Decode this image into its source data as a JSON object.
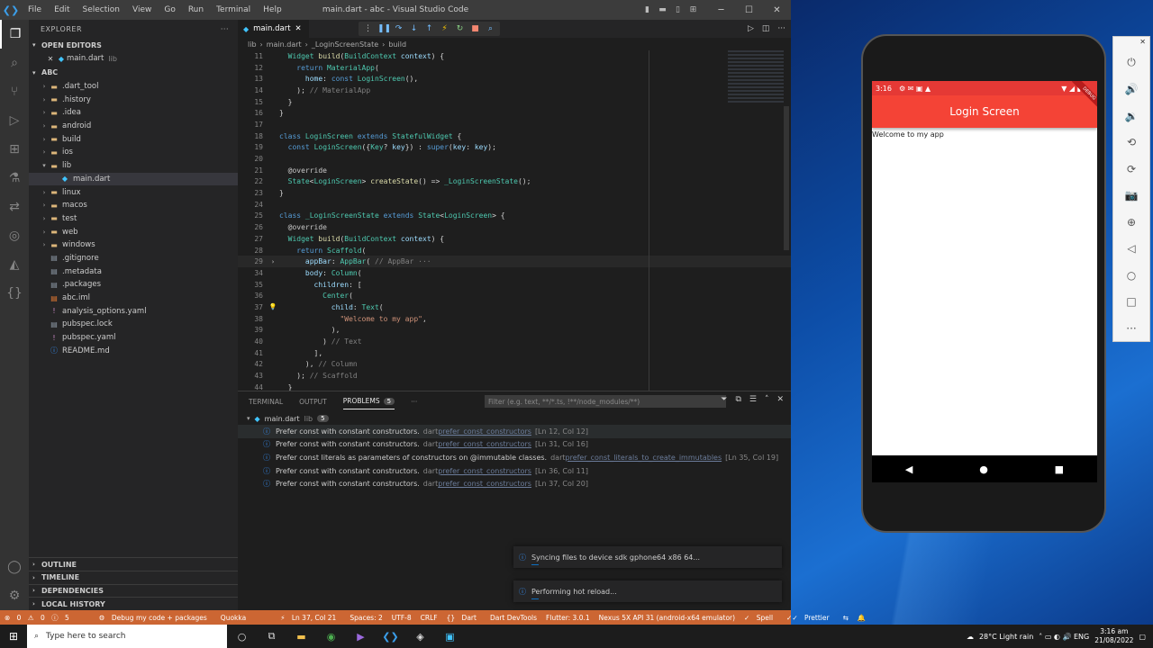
{
  "titlebar": {
    "title": "main.dart - abc - Visual Studio Code",
    "menu": [
      "File",
      "Edit",
      "Selection",
      "View",
      "Go",
      "Run",
      "Terminal",
      "Help"
    ]
  },
  "sidebar": {
    "header": "EXPLORER",
    "open_editors": "OPEN EDITORS",
    "open_file": "main.dart",
    "open_file_dir": "lib",
    "project": "ABC",
    "tree": [
      {
        "name": ".dart_tool",
        "folder": true,
        "depth": 1,
        "open": false
      },
      {
        "name": ".history",
        "folder": true,
        "depth": 1,
        "open": false
      },
      {
        "name": ".idea",
        "folder": true,
        "depth": 1,
        "open": false
      },
      {
        "name": "android",
        "folder": true,
        "depth": 1,
        "open": false
      },
      {
        "name": "build",
        "folder": true,
        "depth": 1,
        "open": false
      },
      {
        "name": "ios",
        "folder": true,
        "depth": 1,
        "open": false
      },
      {
        "name": "lib",
        "folder": true,
        "depth": 1,
        "open": true
      },
      {
        "name": "main.dart",
        "folder": false,
        "depth": 2,
        "selected": true
      },
      {
        "name": "linux",
        "folder": true,
        "depth": 1,
        "open": false
      },
      {
        "name": "macos",
        "folder": true,
        "depth": 1,
        "open": false
      },
      {
        "name": "test",
        "folder": true,
        "depth": 1,
        "open": false
      },
      {
        "name": "web",
        "folder": true,
        "depth": 1,
        "open": false
      },
      {
        "name": "windows",
        "folder": true,
        "depth": 1,
        "open": false
      },
      {
        "name": ".gitignore",
        "folder": false,
        "depth": 1
      },
      {
        "name": ".metadata",
        "folder": false,
        "depth": 1
      },
      {
        "name": ".packages",
        "folder": false,
        "depth": 1
      },
      {
        "name": "abc.iml",
        "folder": false,
        "depth": 1
      },
      {
        "name": "analysis_options.yaml",
        "folder": false,
        "depth": 1
      },
      {
        "name": "pubspec.lock",
        "folder": false,
        "depth": 1
      },
      {
        "name": "pubspec.yaml",
        "folder": false,
        "depth": 1
      },
      {
        "name": "README.md",
        "folder": false,
        "depth": 1
      }
    ],
    "bottom_sections": [
      "OUTLINE",
      "TIMELINE",
      "DEPENDENCIES",
      "LOCAL HISTORY"
    ]
  },
  "editor": {
    "tab": "main.dart",
    "breadcrumb": [
      "lib",
      "main.dart",
      "_LoginScreenState",
      "build"
    ],
    "lines": [
      {
        "n": "11",
        "html": "  <span class='ty'>Widget</span> <span class='fn'>build</span>(<span class='ty'>BuildContext</span> <span class='pm'>context</span>) {"
      },
      {
        "n": "12",
        "html": "    <span class='kw'>return</span> <span class='ty'>MaterialApp</span>("
      },
      {
        "n": "13",
        "html": "      <span class='pm'>home</span>: <span class='kw'>const</span> <span class='ty'>LoginScreen</span>(),"
      },
      {
        "n": "14",
        "html": "    ); <span class='cm'>// MaterialApp</span>"
      },
      {
        "n": "15",
        "html": "  }"
      },
      {
        "n": "16",
        "html": "}"
      },
      {
        "n": "17",
        "html": ""
      },
      {
        "n": "18",
        "html": "<span class='kw'>class</span> <span class='ty'>LoginScreen</span> <span class='kw'>extends</span> <span class='ty'>StatefulWidget</span> {"
      },
      {
        "n": "19",
        "html": "  <span class='kw'>const</span> <span class='ty'>LoginScreen</span>({<span class='ty'>Key</span>? <span class='pm'>key</span>}) : <span class='kw'>super</span>(<span class='pm'>key</span>: <span class='pm'>key</span>);"
      },
      {
        "n": "20",
        "html": ""
      },
      {
        "n": "21",
        "html": "  <span class='an'>@override</span>"
      },
      {
        "n": "22",
        "html": "  <span class='ty'>State</span>&lt;<span class='ty'>LoginScreen</span>&gt; <span class='fn'>createState</span>() =&gt; <span class='ty'>_LoginScreenState</span>();"
      },
      {
        "n": "23",
        "html": "}"
      },
      {
        "n": "24",
        "html": ""
      },
      {
        "n": "25",
        "html": "<span class='kw'>class</span> <span class='ty'>_LoginScreenState</span> <span class='kw'>extends</span> <span class='ty'>State</span>&lt;<span class='ty'>LoginScreen</span>&gt; {"
      },
      {
        "n": "26",
        "html": "  <span class='an'>@override</span>"
      },
      {
        "n": "27",
        "html": "  <span class='ty'>Widget</span> <span class='fn'>build</span>(<span class='ty'>BuildContext</span> <span class='pm'>context</span>) {"
      },
      {
        "n": "28",
        "html": "    <span class='kw'>return</span> <span class='ty'>Scaffold</span>("
      },
      {
        "n": "29",
        "html": "      <span class='pm'>appBar</span>: <span class='ty'>AppBar</span>( <span class='cm'>// AppBar ···</span>",
        "fold": "›",
        "cur": true
      },
      {
        "n": "34",
        "html": "      <span class='pm'>body</span>: <span class='ty'>Column</span>("
      },
      {
        "n": "35",
        "html": "        <span class='pm'>children</span>: ["
      },
      {
        "n": "36",
        "html": "          <span class='ty'>Center</span>("
      },
      {
        "n": "37",
        "html": "            <span class='pm'>child</span>: <span class='ty'>Text</span>(",
        "bulb": true
      },
      {
        "n": "38",
        "html": "              <span class='str'>\"Welcome to my app\"</span>,"
      },
      {
        "n": "39",
        "html": "            ),"
      },
      {
        "n": "40",
        "html": "          ) <span class='cm'>// Text</span>"
      },
      {
        "n": "41",
        "html": "        ],"
      },
      {
        "n": "42",
        "html": "      ), <span class='cm'>// Column</span>"
      },
      {
        "n": "43",
        "html": "    ); <span class='cm'>// Scaffold</span>"
      },
      {
        "n": "44",
        "html": "  }"
      }
    ]
  },
  "panel": {
    "tabs": [
      "TERMINAL",
      "OUTPUT",
      "PROBLEMS"
    ],
    "problems_count": "5",
    "filter_placeholder": "Filter (e.g. text, **/*.ts, !**/node_modules/**)",
    "file": "main.dart",
    "file_dir": "lib",
    "file_count": "5",
    "problems": [
      {
        "msg": "Prefer const with constant constructors.",
        "src": "dart",
        "rule": "prefer_const_constructors",
        "pos": "[Ln 12, Col 12]"
      },
      {
        "msg": "Prefer const with constant constructors.",
        "src": "dart",
        "rule": "prefer_const_constructors",
        "pos": "[Ln 31, Col 16]"
      },
      {
        "msg": "Prefer const literals as parameters of constructors on @immutable classes.",
        "src": "dart",
        "rule": "prefer_const_literals_to_create_immutables",
        "pos": "[Ln 35, Col 19]"
      },
      {
        "msg": "Prefer const with constant constructors.",
        "src": "dart",
        "rule": "prefer_const_constructors",
        "pos": "[Ln 36, Col 11]"
      },
      {
        "msg": "Prefer const with constant constructors.",
        "src": "dart",
        "rule": "prefer_const_constructors",
        "pos": "[Ln 37, Col 20]"
      }
    ]
  },
  "toasts": [
    "Syncing files to device sdk gphone64 x86 64...",
    "Performing hot reload..."
  ],
  "statusbar": {
    "errors": "0",
    "warnings": "0",
    "infos": "5",
    "debug": "Debug my code + packages",
    "quokka": "Quokka",
    "position": "Ln 37, Col 21",
    "spaces": "Spaces: 2",
    "encoding": "UTF-8",
    "eol": "CRLF",
    "lang": "Dart",
    "devtools": "Dart DevTools",
    "flutter": "Flutter: 3.0.1",
    "device": "Nexus 5X API 31 (android-x64 emulator)",
    "spell": "Spell",
    "prettier": "Prettier"
  },
  "phone": {
    "time": "3:16",
    "appbar_title": "Login Screen",
    "body_text": "Welcome to my app",
    "ribbon": "DEBUG"
  },
  "taskbar": {
    "search_placeholder": "Type here to search",
    "weather": "28°C  Light rain",
    "time": "3:16 am",
    "date": "21/08/2022"
  },
  "colors": {
    "statusbar": "#cc6633",
    "appbar": "#f44336"
  }
}
